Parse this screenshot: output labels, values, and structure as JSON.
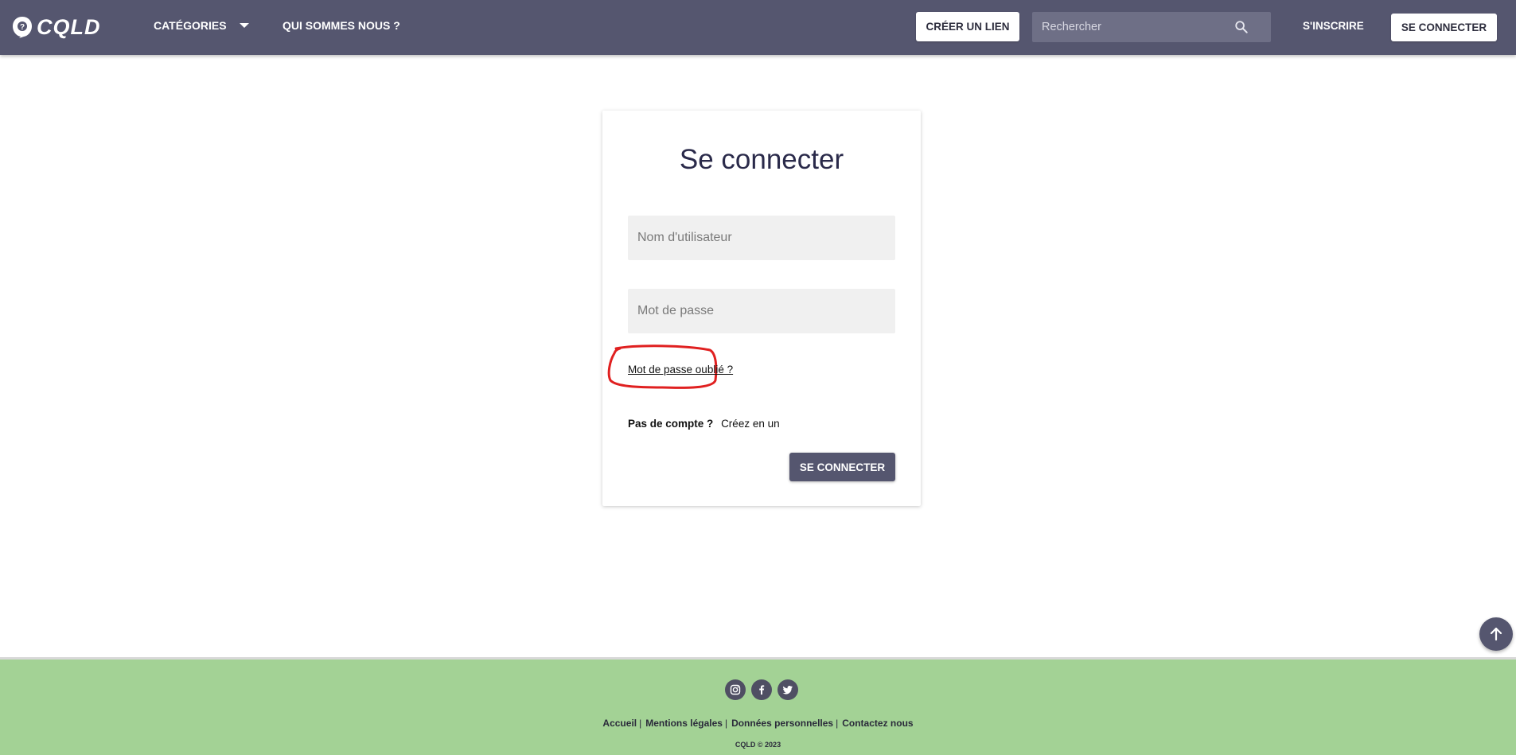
{
  "header": {
    "logo_text": "CQLD",
    "categories_label": "CATÉGORIES",
    "about_label": "QUI SOMMES NOUS ?",
    "create_link_label": "CRÉER UN LIEN",
    "search_placeholder": "Rechercher",
    "signup_label": "S'INSCRIRE",
    "login_label": "SE CONNECTER"
  },
  "login_card": {
    "title": "Se connecter",
    "username_placeholder": "Nom d'utilisateur",
    "password_placeholder": "Mot de passe",
    "forgot_password": "Mot de passe oublié ?",
    "no_account": "Pas de compte ?",
    "create_account": "Créez en un",
    "submit_label": "SE CONNECTER"
  },
  "footer": {
    "socials": [
      "instagram-icon",
      "facebook-icon",
      "twitter-icon"
    ],
    "links": [
      "Accueil",
      "Mentions légales",
      "Données personnelles",
      "Contactez nous"
    ],
    "separator": "|",
    "copyright": "CQLD © 2023"
  },
  "colors": {
    "header_bg": "#55566f",
    "footer_bg": "#a3d295",
    "highlight": "#e02020"
  }
}
